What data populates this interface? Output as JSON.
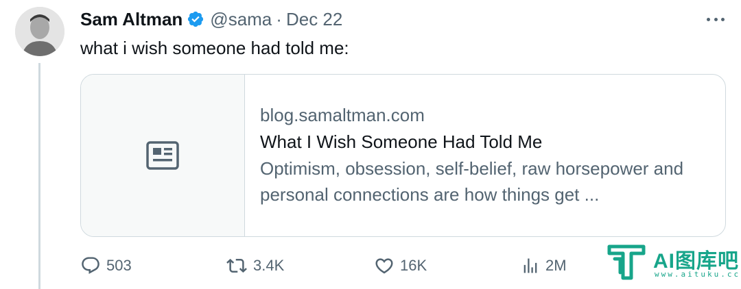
{
  "tweet": {
    "author_name": "Sam Altman",
    "handle": "@sama",
    "separator": "·",
    "date": "Dec 22",
    "text": "what i wish someone had told me:",
    "verified_icon": "verified-badge-icon",
    "more_icon": "more-horizontal-icon"
  },
  "card": {
    "domain": "blog.samaltman.com",
    "title": "What I Wish Someone Had Told Me",
    "description": "Optimism, obsession, self-belief, raw horsepower and personal connections are how things get ...",
    "media_icon": "article-icon"
  },
  "actions": {
    "replies": "503",
    "retweets": "3.4K",
    "likes": "16K",
    "views": "2M"
  },
  "watermark": {
    "text": "AI图库吧",
    "url": "www.aituku.cc"
  },
  "colors": {
    "text_primary": "#0f1419",
    "text_secondary": "#536471",
    "verified_blue": "#1d9bf0",
    "border": "#cfd9de",
    "watermark_green": "#17a58a"
  }
}
